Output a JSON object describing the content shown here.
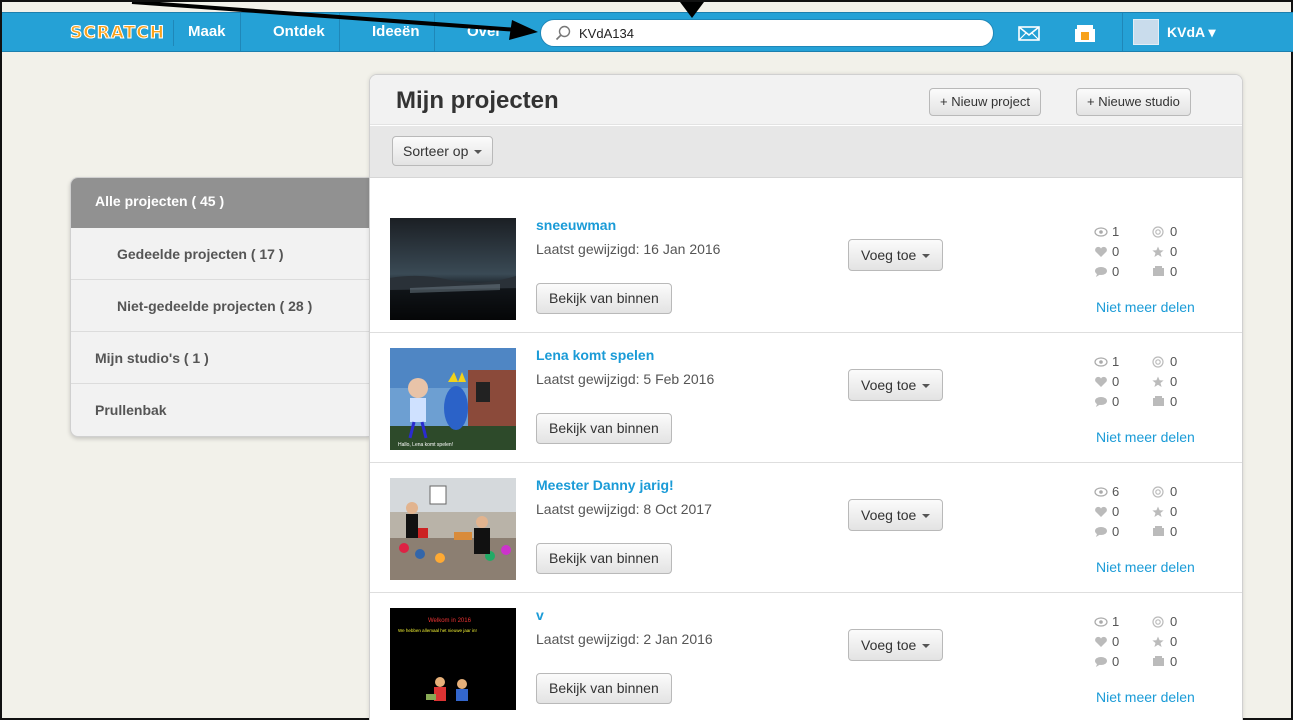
{
  "nav": {
    "logo_text": "SCRATCH",
    "items": [
      "Maak",
      "Ontdek",
      "Ideeën",
      "Over"
    ],
    "search_value": "KVdA134",
    "messages_icon": "envelope-icon",
    "mystuff_icon": "folder-icon",
    "username": "KVdA",
    "user_caret": "▾"
  },
  "sidebar": {
    "items": [
      {
        "label": "Alle projecten ( 45 )"
      },
      {
        "label": "Gedeelde projecten ( 17 )"
      },
      {
        "label": "Niet-gedeelde projecten ( 28 )"
      },
      {
        "label": "Mijn studio's ( 1 )"
      },
      {
        "label": "Prullenbak"
      }
    ]
  },
  "main": {
    "title": "Mijn projecten",
    "new_project_label": "+ Nieuw project",
    "new_studio_label": "+ Nieuwe studio",
    "sort_label": "Sorteer op",
    "add_label": "Voeg toe",
    "inside_label": "Bekijk van binnen",
    "unshare_label": "Niet meer delen",
    "projects": [
      {
        "title": "sneeuwman",
        "date": "Laatst gewijzigd: 16 Jan 2016",
        "views": "1",
        "remixes": "0",
        "loves": "0",
        "favorites": "0",
        "comments": "0",
        "studios": "0"
      },
      {
        "title": "Lena komt spelen",
        "date": "Laatst gewijzigd: 5 Feb 2016",
        "views": "1",
        "remixes": "0",
        "loves": "0",
        "favorites": "0",
        "comments": "0",
        "studios": "0",
        "thumb_caption": "Hallo, Lena komt spelen!"
      },
      {
        "title": "Meester Danny jarig!",
        "date": "Laatst gewijzigd: 8 Oct 2017",
        "views": "6",
        "remixes": "0",
        "loves": "0",
        "favorites": "0",
        "comments": "0",
        "studios": "0"
      },
      {
        "title": "v",
        "date": "Laatst gewijzigd: 2 Jan 2016",
        "views": "1",
        "remixes": "0",
        "loves": "0",
        "favorites": "0",
        "comments": "0",
        "studios": "0",
        "thumb_line1": "Welkom in 2016",
        "thumb_line2": "We hebben allemaal het nieuwe jaar in!"
      }
    ]
  },
  "colors": {
    "topbar": "#25a1d6",
    "link": "#1a9bd7",
    "sidebar_active": "#919191"
  }
}
